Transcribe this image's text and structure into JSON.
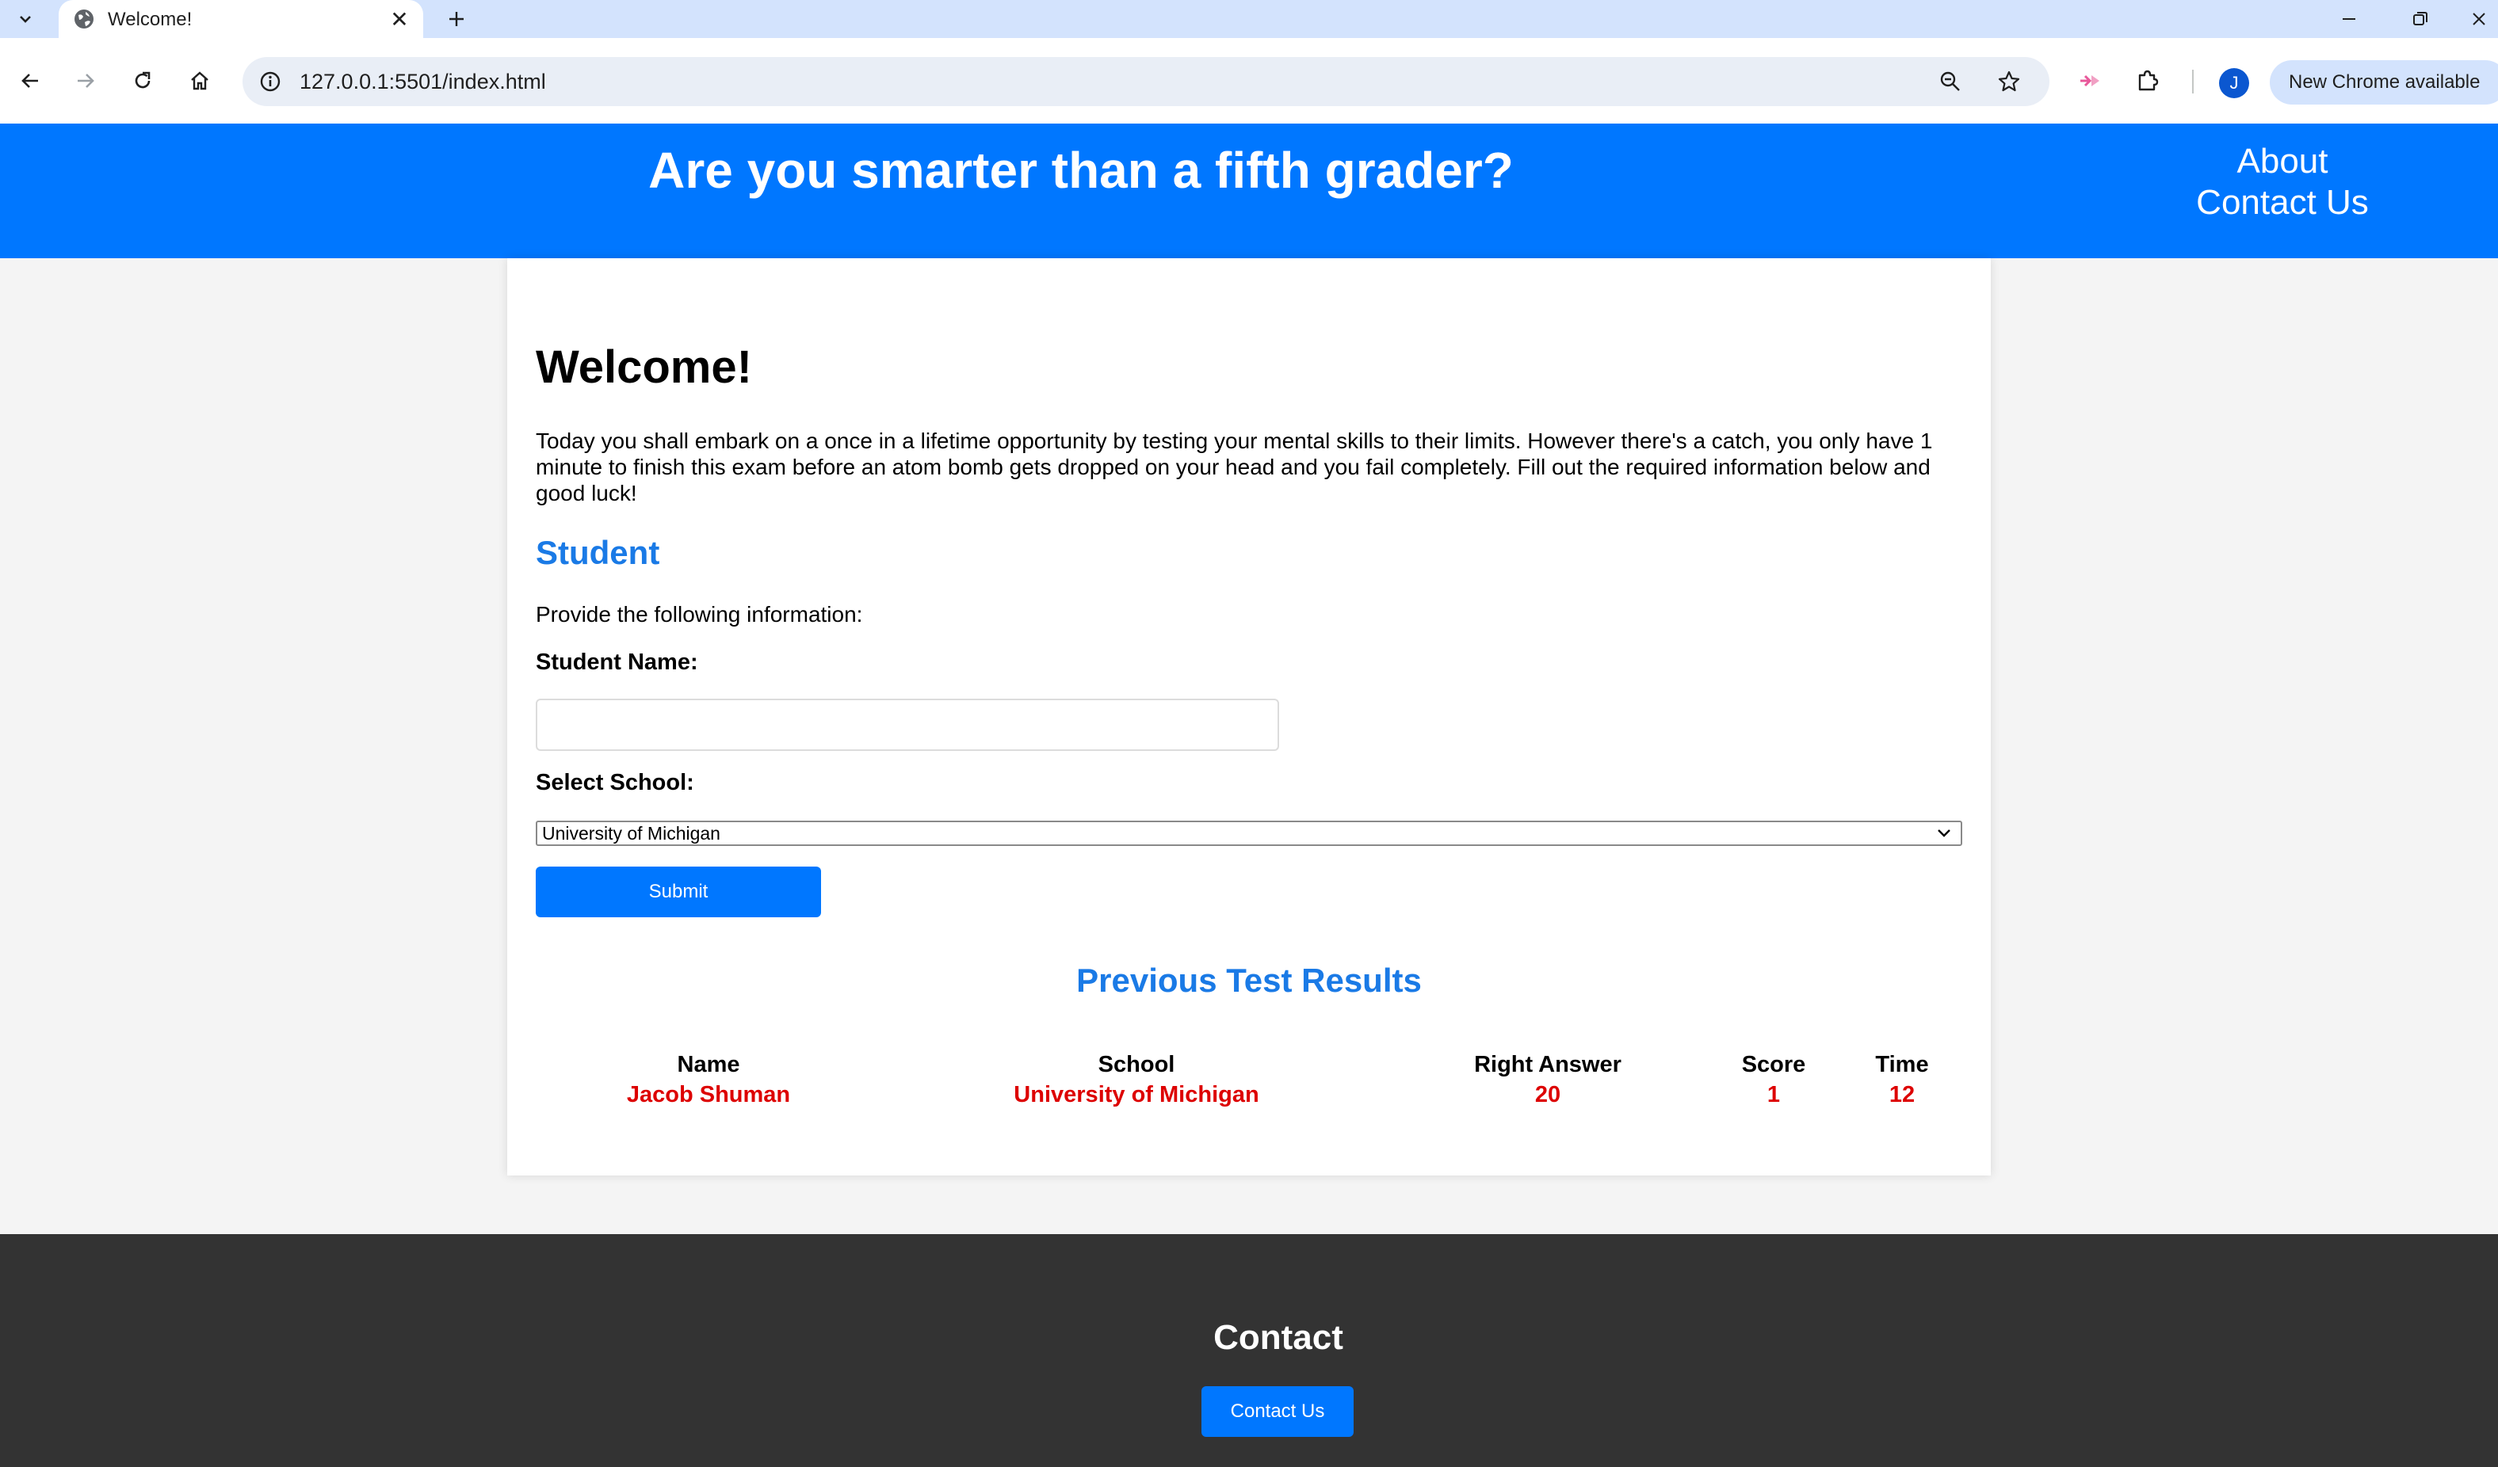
{
  "browser": {
    "tab_title": "Welcome!",
    "url": "127.0.0.1:5501/index.html",
    "update_chip": "New Chrome available",
    "avatar_initial": "J"
  },
  "header": {
    "title": "Are you smarter than a fifth grader?",
    "nav": [
      "About",
      "Contact Us"
    ]
  },
  "main": {
    "heading": "Welcome!",
    "intro": "Today you shall embark on a once in a lifetime opportunity by testing your mental skills to their limits. However there's a catch, you only have 1 minute to finish this exam before an atom bomb gets dropped on your head and you fail completely. Fill out the required information below and good luck!",
    "student_heading": "Student",
    "provide_text": "Provide the following information:",
    "name_label": "Student Name:",
    "name_value": "",
    "school_label": "Select School:",
    "school_selected": "University of Michigan",
    "submit_label": "Submit"
  },
  "results": {
    "heading": "Previous Test Results",
    "columns": [
      "Name",
      "School",
      "Right Answer",
      "Score",
      "Time"
    ],
    "rows": [
      [
        "Jacob Shuman",
        "University of Michigan",
        "20",
        "1",
        "12"
      ]
    ]
  },
  "footer": {
    "heading": "Contact",
    "button_label": "Contact Us"
  },
  "colors": {
    "primary": "#0077ff",
    "accent_heading": "#1a7ae6",
    "result_text": "#dd0000",
    "footer_bg": "#333333"
  }
}
